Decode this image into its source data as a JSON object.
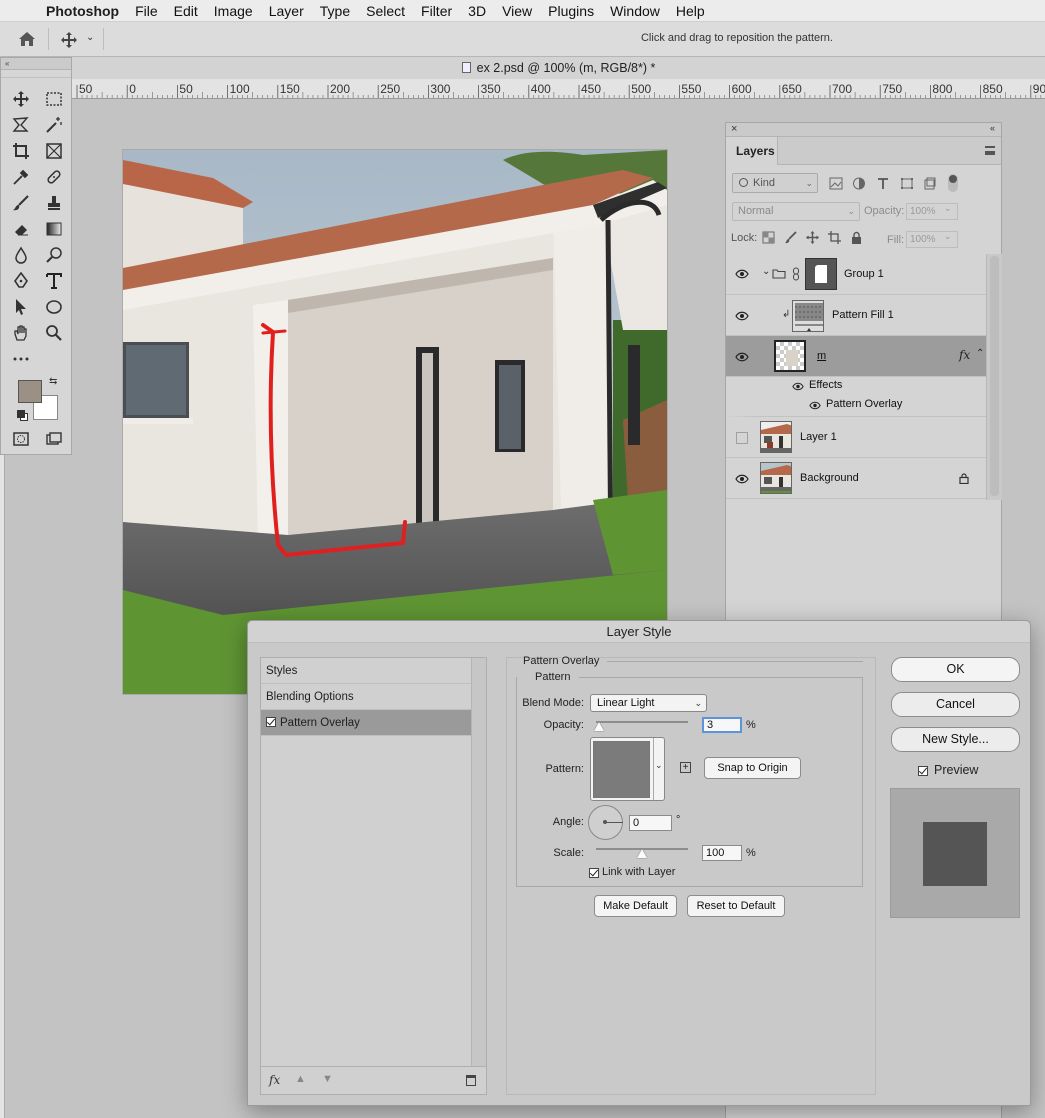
{
  "menubar": {
    "app_name": "Photoshop",
    "items": [
      "File",
      "Edit",
      "Image",
      "Layer",
      "Type",
      "Select",
      "Filter",
      "3D",
      "View",
      "Plugins",
      "Window",
      "Help"
    ]
  },
  "options_bar": {
    "hint": "Click and drag to reposition the pattern."
  },
  "document": {
    "title": "ex 2.psd @ 100% (m, RGB/8*) *"
  },
  "ruler": {
    "ticks": [
      "50",
      "0",
      "50",
      "100",
      "150",
      "200",
      "250",
      "300",
      "350",
      "400",
      "450",
      "500",
      "550",
      "600",
      "650",
      "700",
      "750",
      "800",
      "850",
      "900"
    ]
  },
  "layers_panel": {
    "tab": "Layers",
    "kind_label": "Kind",
    "blend_mode": "Normal",
    "opacity_label": "Opacity:",
    "opacity_value": "100%",
    "lock_label": "Lock:",
    "fill_label": "Fill:",
    "fill_value": "100%",
    "layers": [
      {
        "name": "Group 1",
        "visible": true
      },
      {
        "name": "Pattern Fill 1",
        "visible": true
      },
      {
        "name": "m",
        "visible": true,
        "selected": true,
        "fx": "fx",
        "effects_label": "Effects",
        "effect": "Pattern Overlay"
      },
      {
        "name": "Layer 1",
        "visible": false
      },
      {
        "name": "Background",
        "visible": true,
        "locked": true
      }
    ]
  },
  "dialog": {
    "title": "Layer Style",
    "styles_list": [
      {
        "label": "Styles"
      },
      {
        "label": "Blending Options"
      },
      {
        "label": "Pattern Overlay",
        "checked": true,
        "selected": true
      }
    ],
    "fx_label": "fx",
    "section_title": "Pattern Overlay",
    "group_title": "Pattern",
    "blend_mode_label": "Blend Mode:",
    "blend_mode_value": "Linear Light",
    "opacity_label": "Opacity:",
    "opacity_value": "3",
    "opacity_unit": "%",
    "opacity_slider": 0.03,
    "pattern_label": "Pattern:",
    "pattern_color": "#7b7b7b",
    "snap_button": "Snap to Origin",
    "angle_label": "Angle:",
    "angle_value": "0",
    "angle_unit": "°",
    "scale_label": "Scale:",
    "scale_value": "100",
    "scale_unit": "%",
    "scale_slider": 0.5,
    "link_label": "Link with Layer",
    "link_checked": true,
    "make_default": "Make Default",
    "reset_default": "Reset to Default",
    "ok": "OK",
    "cancel": "Cancel",
    "new_style": "New Style...",
    "preview_label": "Preview",
    "preview_checked": true,
    "preview_swatch_color": "#555555"
  },
  "colors": {
    "foreground": "#9a9084",
    "background": "#ffffff",
    "annotation_red": "#e0201e"
  }
}
